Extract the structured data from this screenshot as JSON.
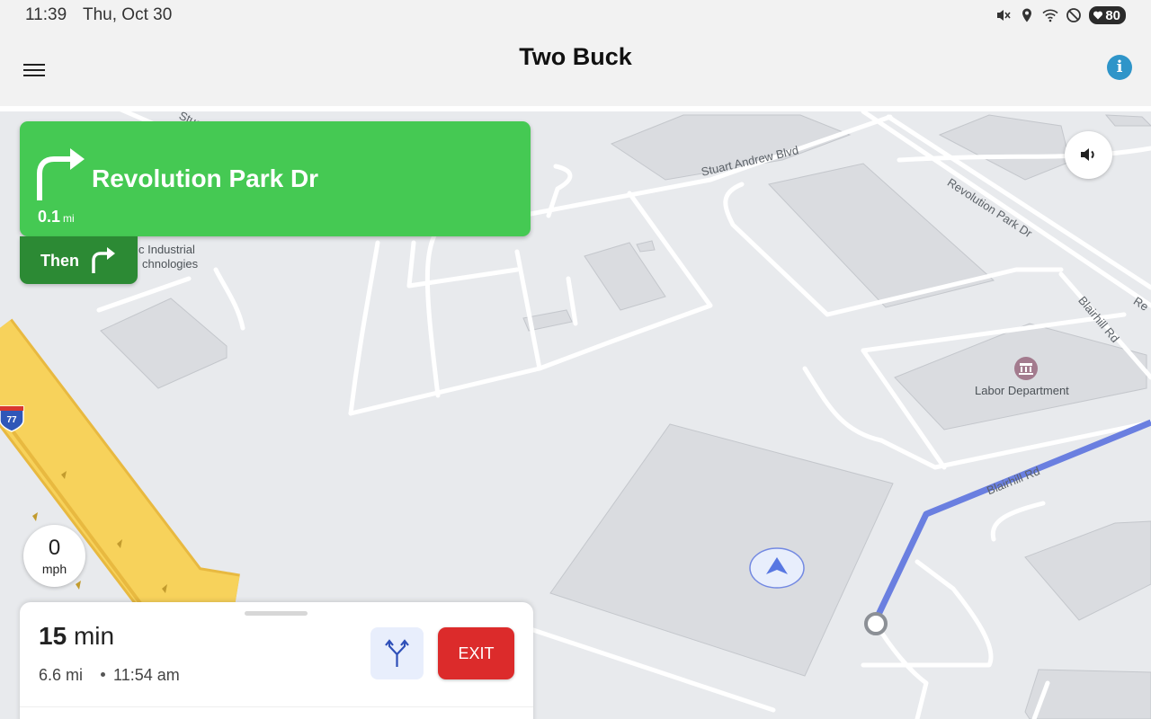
{
  "status_bar": {
    "time": "11:39",
    "date": "Thu, Oct 30",
    "battery": "80",
    "icons": [
      "mute-icon",
      "location-icon",
      "wifi-icon",
      "do-not-disturb-icon",
      "battery-icon"
    ]
  },
  "app_bar": {
    "title": "Two Buck",
    "menu_icon": "hamburger-menu-icon",
    "info_icon": "info-icon",
    "info_glyph": "i"
  },
  "navigation": {
    "next_street": "Revolution Park Dr",
    "distance_value": "0.1",
    "distance_unit": "mi",
    "maneuver_icon": "turn-right-icon",
    "then_label": "Then",
    "then_icon": "turn-right-icon"
  },
  "map": {
    "labels": {
      "stuart_andrew": "Stuart Andrew Blvd",
      "revolution_park": "Revolution Park Dr",
      "revolution_park_cut": "Re",
      "blairhill_upper": "Blairhill Rd",
      "blairhill_lower": "Blairhill Rd",
      "industrial_1": "c Industrial",
      "industrial_2": "chnologies",
      "labor_department": "Labor Department",
      "interstate_shield": "77",
      "top_cut": "Stuart A"
    },
    "route_color": "#6a7fe0",
    "highway_color": "#f7d25b"
  },
  "speedometer": {
    "value": "0",
    "unit": "mph"
  },
  "trip": {
    "minutes": "15",
    "minutes_unit": "min",
    "distance": "6.6 mi",
    "arrival": "11:54 am",
    "alternate_routes_icon": "alternate-routes-icon",
    "exit_label": "EXIT"
  },
  "colors": {
    "turn_card": "#45c953",
    "then_card": "#2c8a34",
    "exit_button": "#dc2b2b",
    "info_button": "#2f95c9"
  }
}
